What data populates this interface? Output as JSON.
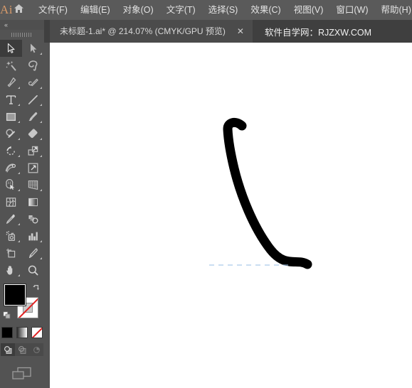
{
  "app": {
    "logo_text": "Ai",
    "home_icon": "home-icon"
  },
  "menubar": {
    "items": [
      {
        "label": "文件(F)",
        "name": "menu-file"
      },
      {
        "label": "编辑(E)",
        "name": "menu-edit"
      },
      {
        "label": "对象(O)",
        "name": "menu-object"
      },
      {
        "label": "文字(T)",
        "name": "menu-type"
      },
      {
        "label": "选择(S)",
        "name": "menu-select"
      },
      {
        "label": "效果(C)",
        "name": "menu-effect"
      },
      {
        "label": "视图(V)",
        "name": "menu-view"
      },
      {
        "label": "窗口(W)",
        "name": "menu-window"
      },
      {
        "label": "帮助(H)",
        "name": "menu-help"
      }
    ]
  },
  "tabbar": {
    "active_tab": {
      "title": "未标题-1.ai* @ 214.07% (CMYK/GPU 预览)",
      "document_name": "未标题-1.ai*",
      "zoom_level": "214.07%",
      "color_mode": "CMYK/GPU 预览",
      "close_label": "✕"
    },
    "watermark": "软件自学网：RJZXW.COM"
  },
  "toolbar": {
    "collapse_label": "«",
    "tools": [
      {
        "name": "selection-tool",
        "label": "选择工具",
        "active": true,
        "corner": false
      },
      {
        "name": "direct-selection-tool",
        "label": "直接选择工具",
        "active": false,
        "corner": true
      },
      {
        "name": "magic-wand-tool",
        "label": "魔棒工具",
        "active": false,
        "corner": false
      },
      {
        "name": "lasso-tool",
        "label": "套索工具",
        "active": false,
        "corner": false
      },
      {
        "name": "pen-tool",
        "label": "钢笔工具",
        "active": false,
        "corner": true
      },
      {
        "name": "curvature-tool",
        "label": "曲率工具",
        "active": false,
        "corner": true
      },
      {
        "name": "type-tool",
        "label": "文字工具",
        "active": false,
        "corner": true
      },
      {
        "name": "line-segment-tool",
        "label": "直线段工具",
        "active": false,
        "corner": true
      },
      {
        "name": "rectangle-tool",
        "label": "矩形工具",
        "active": false,
        "corner": true
      },
      {
        "name": "paintbrush-tool",
        "label": "画笔工具",
        "active": false,
        "corner": true
      },
      {
        "name": "shaper-tool",
        "label": "Shaper 工具",
        "active": false,
        "corner": true
      },
      {
        "name": "eraser-tool",
        "label": "橡皮擦工具",
        "active": false,
        "corner": true
      },
      {
        "name": "rotate-tool",
        "label": "旋转工具",
        "active": false,
        "corner": true
      },
      {
        "name": "scale-tool",
        "label": "比例缩放工具",
        "active": false,
        "corner": true
      },
      {
        "name": "width-tool",
        "label": "宽度工具",
        "active": false,
        "corner": true
      },
      {
        "name": "free-transform-tool",
        "label": "自由变换工具",
        "active": false,
        "corner": false
      },
      {
        "name": "shape-builder-tool",
        "label": "形状生成器工具",
        "active": false,
        "corner": true
      },
      {
        "name": "perspective-grid-tool",
        "label": "透视网格工具",
        "active": false,
        "corner": true
      },
      {
        "name": "mesh-tool",
        "label": "网格工具",
        "active": false,
        "corner": false
      },
      {
        "name": "gradient-tool",
        "label": "渐变工具",
        "active": false,
        "corner": false
      },
      {
        "name": "eyedropper-tool",
        "label": "吸管工具",
        "active": false,
        "corner": true
      },
      {
        "name": "blend-tool",
        "label": "混合工具",
        "active": false,
        "corner": false
      },
      {
        "name": "symbol-sprayer-tool",
        "label": "符号喷枪工具",
        "active": false,
        "corner": true
      },
      {
        "name": "column-graph-tool",
        "label": "柱形图工具",
        "active": false,
        "corner": true
      },
      {
        "name": "artboard-tool",
        "label": "画板工具",
        "active": false,
        "corner": false
      },
      {
        "name": "slice-tool",
        "label": "切片工具",
        "active": false,
        "corner": true
      },
      {
        "name": "hand-tool",
        "label": "抓手工具",
        "active": false,
        "corner": true
      },
      {
        "name": "zoom-tool",
        "label": "缩放工具",
        "active": false,
        "corner": false
      }
    ],
    "color_controls": {
      "fill_color": "#000000",
      "stroke_color": "none",
      "fill_label": "填色",
      "stroke_label": "描边",
      "swap_icon": "swap-fill-stroke-icon",
      "default_icon": "default-fill-stroke-icon"
    },
    "paint_modes": [
      {
        "name": "color-mode-button",
        "label": "颜色",
        "color": "#000000"
      },
      {
        "name": "gradient-mode-button",
        "label": "渐变",
        "color": "#888888"
      },
      {
        "name": "none-mode-button",
        "label": "无",
        "color": "#ffffff"
      }
    ],
    "draw_modes": [
      {
        "name": "draw-normal-button",
        "label": "正常绘图",
        "active": true
      },
      {
        "name": "draw-behind-button",
        "label": "背面绘图",
        "active": false
      },
      {
        "name": "draw-inside-button",
        "label": "内部绘图",
        "active": false
      }
    ],
    "screen_mode": {
      "name": "change-screen-mode-button",
      "label": "更改屏幕模式"
    }
  },
  "canvas": {
    "background": "#ffffff",
    "artwork": {
      "name": "brush-stroke-path",
      "description": "黑色画笔曲线",
      "color": "#000000"
    },
    "guide": {
      "name": "dashed-guide",
      "color": "#9fc3e8"
    }
  },
  "colors": {
    "menubar_bg": "#5a5a5a",
    "tabbar_bg": "#3f3f3f",
    "tab_active_bg": "#4b4b4b",
    "toolbar_bg": "#535353",
    "canvas_bg": "#ffffff",
    "accent": "#d79a6a",
    "text": "#e3e3e3"
  }
}
